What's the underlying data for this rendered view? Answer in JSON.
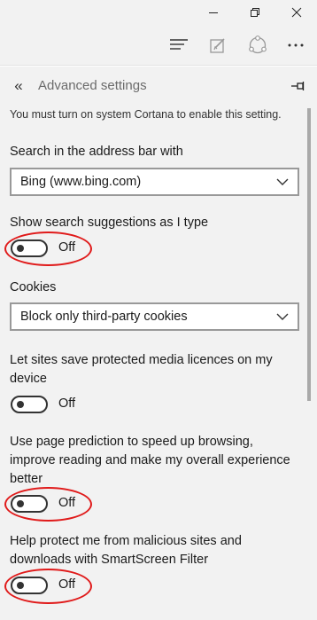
{
  "window_controls": {
    "minimize_icon": "minimize-icon",
    "restore_icon": "restore-icon",
    "close_icon": "close-icon"
  },
  "toolbar": {
    "hub_icon": "hub-icon",
    "note_icon": "web-note-icon",
    "share_icon": "share-icon",
    "more_icon": "more-ellipsis-icon"
  },
  "panel": {
    "back_glyph": "«",
    "title": "Advanced settings",
    "pin_icon": "pin-icon"
  },
  "settings": {
    "cortana_note": "You must turn on system Cortana to enable this setting.",
    "search_label": "Search in the address bar with",
    "search_value": "Bing (www.bing.com)",
    "suggestions_label": "Show search suggestions as I type",
    "suggestions_state": "Off",
    "cookies_label": "Cookies",
    "cookies_value": "Block only third-party cookies",
    "media_label": "Let sites save protected media licences on my device",
    "media_state": "Off",
    "prediction_label": "Use page prediction to speed up browsing, improve reading and make my overall experience better",
    "prediction_state": "Off",
    "smartscreen_label": "Help protect me from malicious sites and downloads with SmartScreen Filter",
    "smartscreen_state": "Off"
  },
  "colors": {
    "annotation_red": "#e01a1a",
    "panel_bg": "#f2f2f2"
  }
}
